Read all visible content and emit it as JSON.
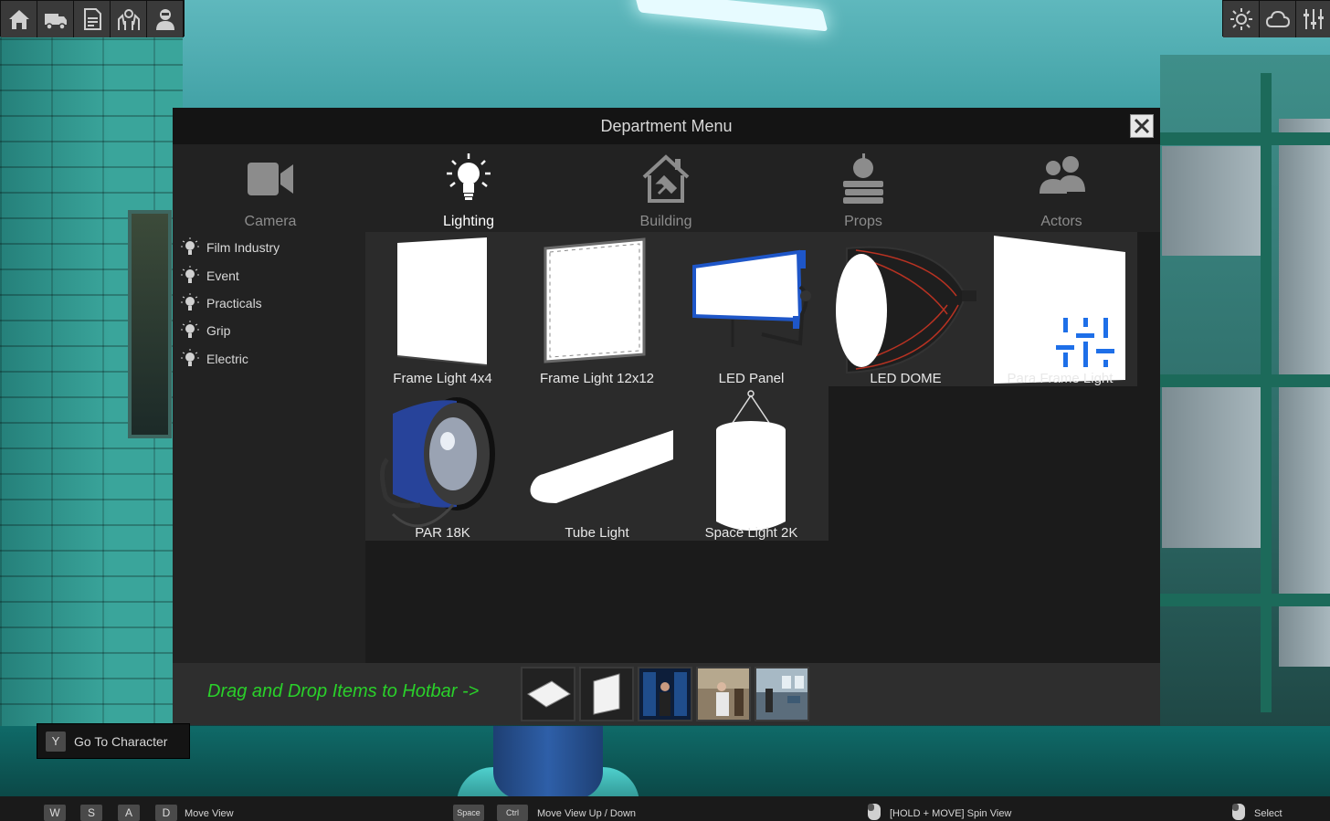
{
  "menu": {
    "title": "Department Menu"
  },
  "departments": [
    {
      "label": "Camera",
      "icon": "camera-icon",
      "active": false
    },
    {
      "label": "Lighting",
      "icon": "lightbulb-icon",
      "active": true
    },
    {
      "label": "Building",
      "icon": "house-tools-icon",
      "active": false
    },
    {
      "label": "Props",
      "icon": "apple-books-icon",
      "active": false
    },
    {
      "label": "Actors",
      "icon": "people-icon",
      "active": false
    }
  ],
  "subcategories": [
    {
      "label": "Film Industry"
    },
    {
      "label": "Event"
    },
    {
      "label": "Practicals"
    },
    {
      "label": "Grip"
    },
    {
      "label": "Electric"
    }
  ],
  "items": [
    {
      "label": "Frame Light 4x4"
    },
    {
      "label": "Frame Light 12x12"
    },
    {
      "label": "LED Panel"
    },
    {
      "label": "LED DOME"
    },
    {
      "label": "Para Frame Light"
    },
    {
      "label": "PAR 18K"
    },
    {
      "label": "Tube Light"
    },
    {
      "label": "Space Light 2K"
    }
  ],
  "hotbar": {
    "hint": "Drag and Drop Items to Hotbar ->"
  },
  "go_to_character": {
    "key": "Y",
    "label": "Go To Character"
  },
  "bottom_bar": {
    "keys_move": [
      "W",
      "S",
      "A",
      "D"
    ],
    "move_label": "Move View",
    "key_space": "Space",
    "key_ctrl": "Ctrl",
    "updown_label": "Move View Up / Down",
    "spin_label": "[HOLD + MOVE] Spin View",
    "select_label": "Select"
  },
  "colors": {
    "hotbar_hint": "#2ad12a",
    "selection_accent": "#1e6fe8"
  }
}
